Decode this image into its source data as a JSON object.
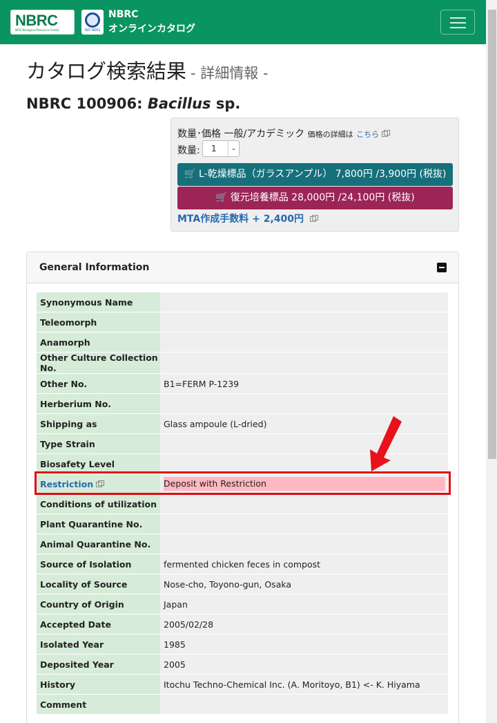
{
  "header": {
    "logo_text": "NBRC",
    "logo_subtext": "NITE Biological Resource Center",
    "iso_text": "ISO 9001",
    "brand_line1": "NBRC",
    "brand_line2": "オンラインカタログ"
  },
  "page": {
    "title": "カタログ検索結果",
    "subtitle": "- 詳細情報 -",
    "strain_id": "NBRC 100906: ",
    "genus": "Bacillus",
    "species": " sp."
  },
  "order": {
    "price_label": "数量･価格 一般/アカデミック",
    "price_detail_text": "価格の詳細は",
    "price_detail_link": "こちら",
    "qty_label": "数量:",
    "qty_value": "1",
    "btn_dry": "L-乾燥標品（ガラスアンプル） 7,800円 /3,900円 (税抜)",
    "btn_culture": "復元培養標品 28,000円 /24,100円 (税抜)",
    "mta_link": "MTA作成手数料 + 2,400円"
  },
  "general_info": {
    "title": "General Information",
    "rows": [
      {
        "key": "Synonymous Name",
        "value": ""
      },
      {
        "key": "Teleomorph",
        "value": ""
      },
      {
        "key": "Anamorph",
        "value": ""
      },
      {
        "key": "Other Culture Collection No.",
        "value": ""
      },
      {
        "key": "Other No.",
        "value": "B1=FERM P-1239"
      },
      {
        "key": "Herberium No.",
        "value": ""
      },
      {
        "key": "Shipping as",
        "value": "Glass ampoule (L-dried)"
      },
      {
        "key": "Type Strain",
        "value": ""
      },
      {
        "key": "Biosafety Level",
        "value": ""
      },
      {
        "key": "Restriction",
        "value": "Deposit with Restriction"
      },
      {
        "key": "Conditions of utilization",
        "value": ""
      },
      {
        "key": "Plant Quarantine No.",
        "value": ""
      },
      {
        "key": "Animal Quarantine No.",
        "value": ""
      },
      {
        "key": "Source of Isolation",
        "value": "fermented chicken feces in compost"
      },
      {
        "key": "Locality of Source",
        "value": "Nose-cho, Toyono-gun, Osaka"
      },
      {
        "key": "Country of Origin",
        "value": "Japan"
      },
      {
        "key": "Accepted Date",
        "value": "2005/02/28"
      },
      {
        "key": "Isolated Year",
        "value": "1985"
      },
      {
        "key": "Deposited Year",
        "value": "2005"
      },
      {
        "key": "History",
        "value": "Itochu Techno-Chemical Inc. (A. Moritoyo, B1) <- K. Hiyama"
      },
      {
        "key": "Comment",
        "value": ""
      }
    ]
  },
  "colors": {
    "navbar": "#0a9462",
    "button_teal": "#16707b",
    "button_magenta": "#9c2457",
    "highlight_border": "#e10b15",
    "highlight_fill": "#ffb8c2",
    "key_cell": "#d6ecd9"
  }
}
